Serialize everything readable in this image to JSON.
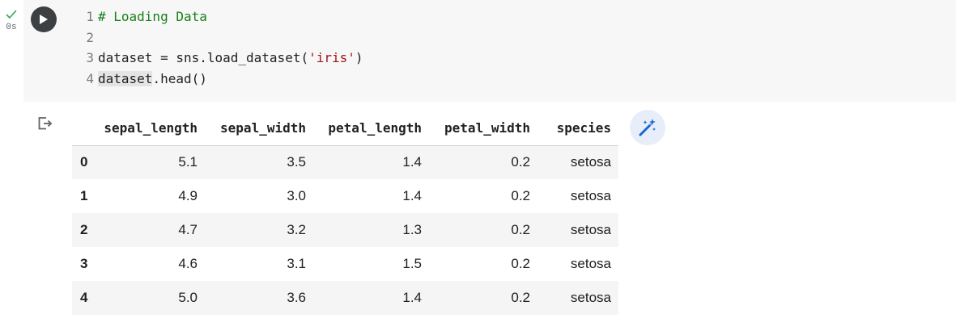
{
  "cell": {
    "status": {
      "icon": "check-icon",
      "time": "0s",
      "color": "#34a853"
    },
    "run_button_icon": "play-icon",
    "code": [
      {
        "num": "1",
        "tokens": [
          {
            "text": "# Loading Data",
            "kind": "comment"
          }
        ]
      },
      {
        "num": "2",
        "tokens": []
      },
      {
        "num": "3",
        "tokens": [
          {
            "text": "dataset = sns.load_dataset(",
            "kind": "plain"
          },
          {
            "text": "'iris'",
            "kind": "string"
          },
          {
            "text": ")",
            "kind": "plain"
          }
        ]
      },
      {
        "num": "4",
        "tokens": [
          {
            "text": "dataset",
            "kind": "hl"
          },
          {
            "text": ".head()",
            "kind": "plain"
          }
        ]
      }
    ]
  },
  "output": {
    "icon": "output-redirect-icon",
    "table": {
      "columns": [
        "sepal_length",
        "sepal_width",
        "petal_length",
        "petal_width",
        "species"
      ],
      "rows": [
        {
          "index": "0",
          "values": [
            "5.1",
            "3.5",
            "1.4",
            "0.2",
            "setosa"
          ]
        },
        {
          "index": "1",
          "values": [
            "4.9",
            "3.0",
            "1.4",
            "0.2",
            "setosa"
          ]
        },
        {
          "index": "2",
          "values": [
            "4.7",
            "3.2",
            "1.3",
            "0.2",
            "setosa"
          ]
        },
        {
          "index": "3",
          "values": [
            "4.6",
            "3.1",
            "1.5",
            "0.2",
            "setosa"
          ]
        },
        {
          "index": "4",
          "values": [
            "5.0",
            "3.6",
            "1.4",
            "0.2",
            "setosa"
          ]
        }
      ]
    },
    "suggest_button_icon": "magic-wand-icon",
    "accent_color": "#1967d2"
  }
}
